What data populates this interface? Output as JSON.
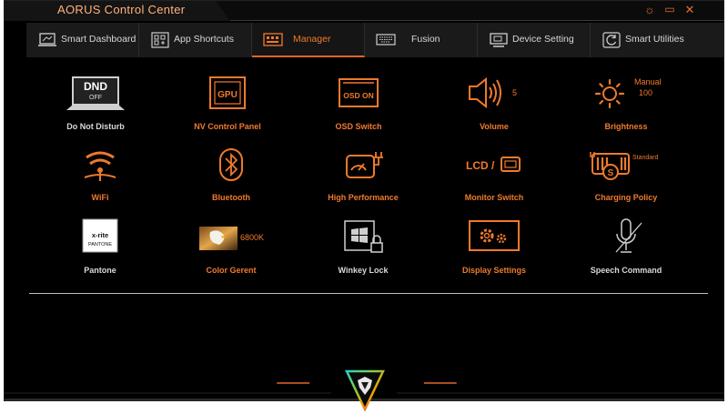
{
  "app": {
    "title": "AORUS Control Center"
  },
  "window_controls": {
    "settings": "☼",
    "restore": "▭",
    "close": "✕"
  },
  "tabs": [
    {
      "label": "Smart Dashboard",
      "icon": "laptop-icon"
    },
    {
      "label": "App Shortcuts",
      "icon": "app-grid-icon"
    },
    {
      "label": "Manager",
      "icon": "manager-panel-icon",
      "active": true
    },
    {
      "label": "Fusion",
      "icon": "keyboard-icon"
    },
    {
      "label": "Device Setting",
      "icon": "monitor-icon"
    },
    {
      "label": "Smart Utilities",
      "icon": "refresh-icon"
    }
  ],
  "manager": {
    "dnd": {
      "label": "Do Not Disturb",
      "icon_text_top": "DND",
      "icon_text_bottom": "OFF"
    },
    "nv": {
      "label": "NV Control Panel",
      "icon_text": "GPU"
    },
    "osd": {
      "label": "OSD Switch",
      "icon_text": "OSD ON"
    },
    "volume": {
      "label": "Volume",
      "value": "5"
    },
    "brightness": {
      "label": "Brightness",
      "mode": "Manual",
      "value": "100"
    },
    "wifi": {
      "label": "WiFi"
    },
    "bluetooth": {
      "label": "Bluetooth"
    },
    "performance": {
      "label": "High Performance"
    },
    "monitor": {
      "label": "Monitor Switch",
      "icon_text": "LCD /"
    },
    "charging": {
      "label": "Charging Policy",
      "mode": "Standard"
    },
    "pantone": {
      "label": "Pantone",
      "logo_top": "x-rite",
      "logo_bottom": "PANTONE"
    },
    "color": {
      "label": "Color Gerent",
      "value": "6800K"
    },
    "winkey": {
      "label": "Winkey Lock"
    },
    "display": {
      "label": "Display Settings"
    },
    "speech": {
      "label": "Speech Command"
    }
  },
  "colors": {
    "accent": "#e2642a",
    "background": "#000000",
    "tab_bg": "#1a1a1a"
  }
}
